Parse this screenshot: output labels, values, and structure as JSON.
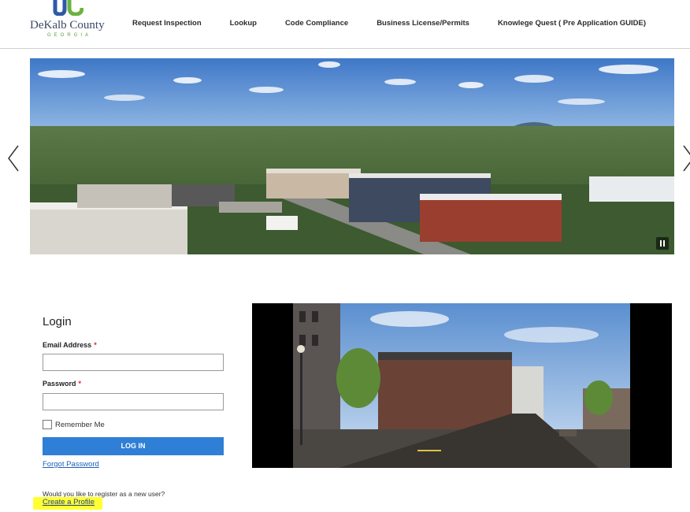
{
  "header": {
    "logo": {
      "name": "DeKalb County",
      "state": "GEORGIA"
    },
    "nav": [
      "Request Inspection",
      "Lookup",
      "Code Compliance",
      "Business License/Permits",
      "Knowlege Quest ( Pre Application GUIDE)"
    ]
  },
  "carousel": {
    "prev_icon": "chevron-left-icon",
    "next_icon": "chevron-right-icon",
    "pause_icon": "pause-icon"
  },
  "login": {
    "title": "Login",
    "email_label": "Email Address",
    "email_value": "",
    "password_label": "Password",
    "password_value": "",
    "required_marker": "*",
    "remember_label": "Remember Me",
    "remember_checked": false,
    "submit_label": "LOG IN",
    "forgot_label": "Forgot Password"
  },
  "register": {
    "question": "Would you like to register as a new user?",
    "link_label": "Create a Profile"
  },
  "colors": {
    "accent": "#2f7fd6",
    "link": "#1f5fb8",
    "required": "#d9262b",
    "highlight": "#ffff33"
  }
}
